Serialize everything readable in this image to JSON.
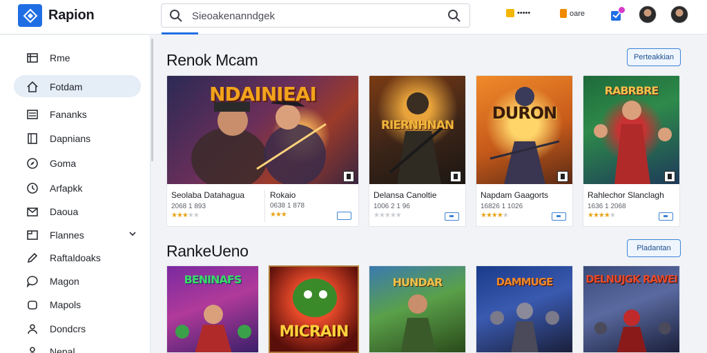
{
  "app": {
    "title": "Rapion"
  },
  "search": {
    "placeholder": "Sieoakenanndgek"
  },
  "header": {
    "coins_label": "•••••",
    "points_label": "oare"
  },
  "sidebar": {
    "items": [
      {
        "label": "Rme",
        "icon": "window-icon"
      },
      {
        "label": "Fotdam",
        "icon": "home-icon",
        "active": true
      },
      {
        "label": "Fananks",
        "icon": "list-icon"
      },
      {
        "label": "Dapnians",
        "icon": "book-icon"
      },
      {
        "label": "Goma",
        "icon": "compass-icon"
      },
      {
        "label": "Arfapkk",
        "icon": "clock-icon"
      },
      {
        "label": "Daoua",
        "icon": "mail-icon"
      },
      {
        "label": "Flannes",
        "icon": "folder-icon",
        "expandable": true
      },
      {
        "label": "Raftaldoaks",
        "icon": "pencil-icon"
      },
      {
        "label": "Magon",
        "icon": "chat-icon"
      },
      {
        "label": "Mapols",
        "icon": "bag-icon"
      },
      {
        "label": "Dondcrs",
        "icon": "people-icon"
      },
      {
        "label": "Nepal",
        "icon": "people-icon"
      }
    ]
  },
  "sections": [
    {
      "title": "Renok Mcam",
      "button": "Perteakkian",
      "cards": [
        {
          "art_text": "NDAINIEAI",
          "name": "Seolaba Datahagua",
          "meta": "2068 1 893",
          "rating": 3
        },
        {
          "art_text": "",
          "name": "Rokaio",
          "meta": "0638 1 878",
          "rating": 3
        },
        {
          "art_text": "RIERNHNAN",
          "name": "Delansa Canoltie",
          "meta": "1006 2 1 96",
          "rating": 0
        },
        {
          "art_text": "DURON",
          "name": "Napdam Gaagorts",
          "meta": "16826 1 1026",
          "rating": 4
        },
        {
          "art_text": "RABRBRE",
          "name": "Rahlechor Slanclagh",
          "meta": "1636 1 2068",
          "rating": 4
        }
      ]
    },
    {
      "title": "RankeUeno",
      "button": "Pladantan",
      "cards": [
        {
          "art_text": "BENINAFS"
        },
        {
          "art_text": "MICRAIN"
        },
        {
          "art_text": "HUNDAR"
        },
        {
          "art_text": "DAMMUGE"
        },
        {
          "art_text": "DELNUJGK RAWEI"
        }
      ]
    }
  ],
  "colors": {
    "accent": "#1f6ee4",
    "active_nav": "#e5edf6",
    "star": "#e8a317"
  }
}
